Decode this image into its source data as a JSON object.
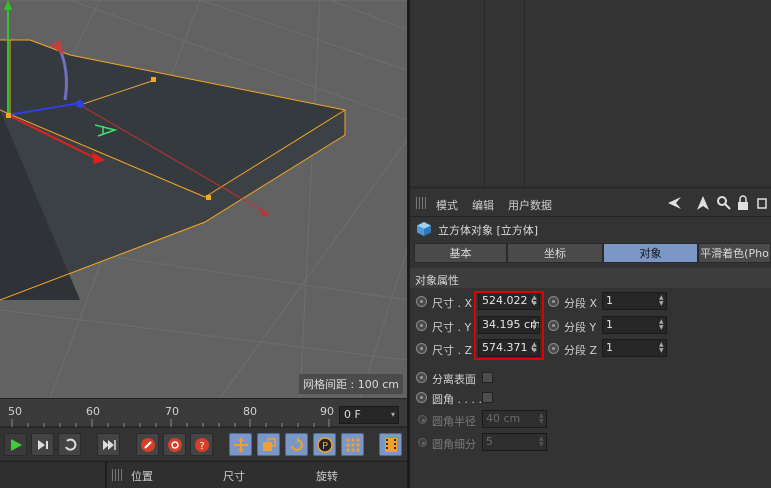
{
  "viewport": {
    "grid_spacing": "网格间距 : 100 cm"
  },
  "attributes": {
    "menu": [
      "模式",
      "编辑",
      "用户数据"
    ],
    "object_title": "立方体对象 [立方体]",
    "tabs": [
      "基本",
      "坐标",
      "对象",
      "平滑着色(Pho"
    ],
    "active_tab": "对象",
    "section": "对象属性",
    "size": [
      {
        "label": "尺寸 . X",
        "value": "524.022 c"
      },
      {
        "label": "尺寸 . Y",
        "value": "34.195 cm"
      },
      {
        "label": "尺寸 . Z",
        "value": "574.371 c"
      }
    ],
    "segments": [
      {
        "label": "分段 X",
        "value": "1"
      },
      {
        "label": "分段 Y",
        "value": "1"
      },
      {
        "label": "分段 Z",
        "value": "1"
      }
    ],
    "separate_surfaces": "分离表面",
    "fillet": "圆角 . . . .",
    "fillet_radius": {
      "label": "圆角半径",
      "value": "40 cm"
    },
    "fillet_subdivision": {
      "label": "圆角细分",
      "value": "5"
    }
  },
  "timeline": {
    "ticks": [
      "50",
      "60",
      "70",
      "80",
      "90"
    ],
    "frame": "0 F"
  },
  "coord_manager": {
    "headers": [
      "位置",
      "尺寸",
      "旋转"
    ]
  },
  "colors": {
    "accent_tab": "#7c97c6",
    "highlight_box": "#e00000",
    "selection_edge": "#f5a623"
  }
}
